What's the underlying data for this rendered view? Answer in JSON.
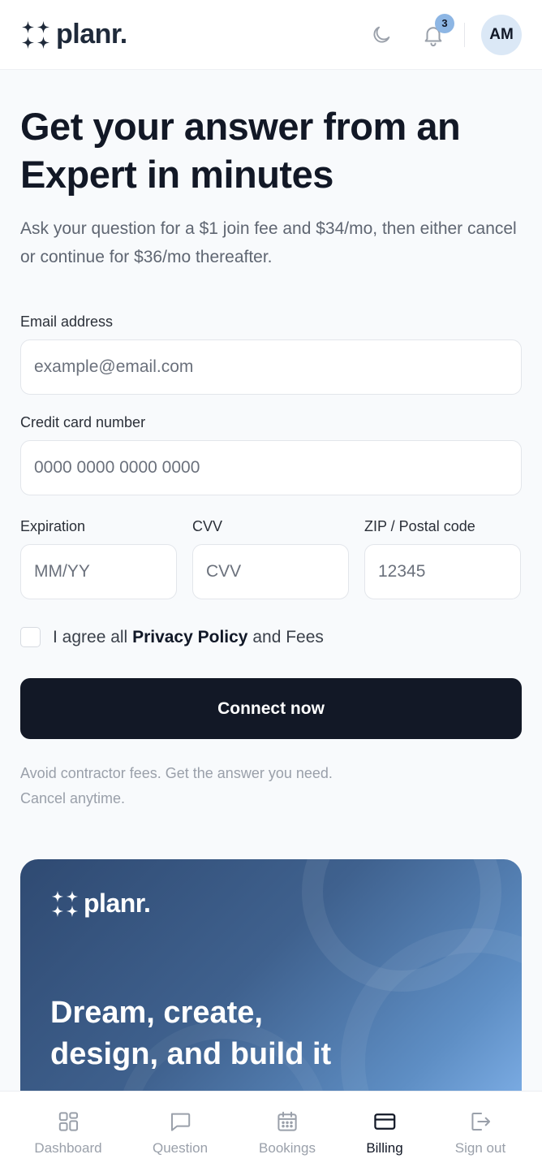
{
  "header": {
    "logo_text": "planr.",
    "notifications_count": "3",
    "avatar_initials": "AM"
  },
  "main": {
    "title": "Get your answer from an Expert in minutes",
    "subtitle": "Ask your question for a $1 join fee and $34/mo, then either cancel or continue for $36/mo thereafter.",
    "form": {
      "email": {
        "label": "Email address",
        "placeholder": "example@email.com",
        "value": ""
      },
      "card": {
        "label": "Credit card number",
        "placeholder": "0000 0000 0000 0000",
        "value": ""
      },
      "expiration": {
        "label": "Expiration",
        "placeholder": "MM/YY",
        "value": ""
      },
      "cvv": {
        "label": "CVV",
        "placeholder": "CVV",
        "value": ""
      },
      "zip": {
        "label": "ZIP / Postal code",
        "placeholder": "12345",
        "value": ""
      },
      "agree": {
        "prefix": "I agree all ",
        "policy": "Privacy Policy",
        "suffix": " and Fees",
        "checked": false
      },
      "submit_label": "Connect now"
    },
    "note_line1": "Avoid contractor fees. Get the answer you need.",
    "note_line2": "Cancel anytime."
  },
  "promo": {
    "logo_text": "planr.",
    "title_line1": "Dream, create,",
    "title_line2": "design, and build it"
  },
  "nav": {
    "items": [
      {
        "label": "Dashboard",
        "icon": "grid-icon",
        "active": false
      },
      {
        "label": "Question",
        "icon": "chat-icon",
        "active": false
      },
      {
        "label": "Bookings",
        "icon": "calendar-icon",
        "active": false
      },
      {
        "label": "Billing",
        "icon": "credit-card-icon",
        "active": true
      },
      {
        "label": "Sign out",
        "icon": "logout-icon",
        "active": false
      }
    ]
  },
  "colors": {
    "primary": "#121826",
    "background": "#f8fafc",
    "badge": "#8db6e4",
    "avatar_bg": "#dbe8f6",
    "muted_text": "#9aa0aa",
    "promo_gradient_start": "#2f4a72",
    "promo_gradient_end": "#7fb0e8"
  }
}
